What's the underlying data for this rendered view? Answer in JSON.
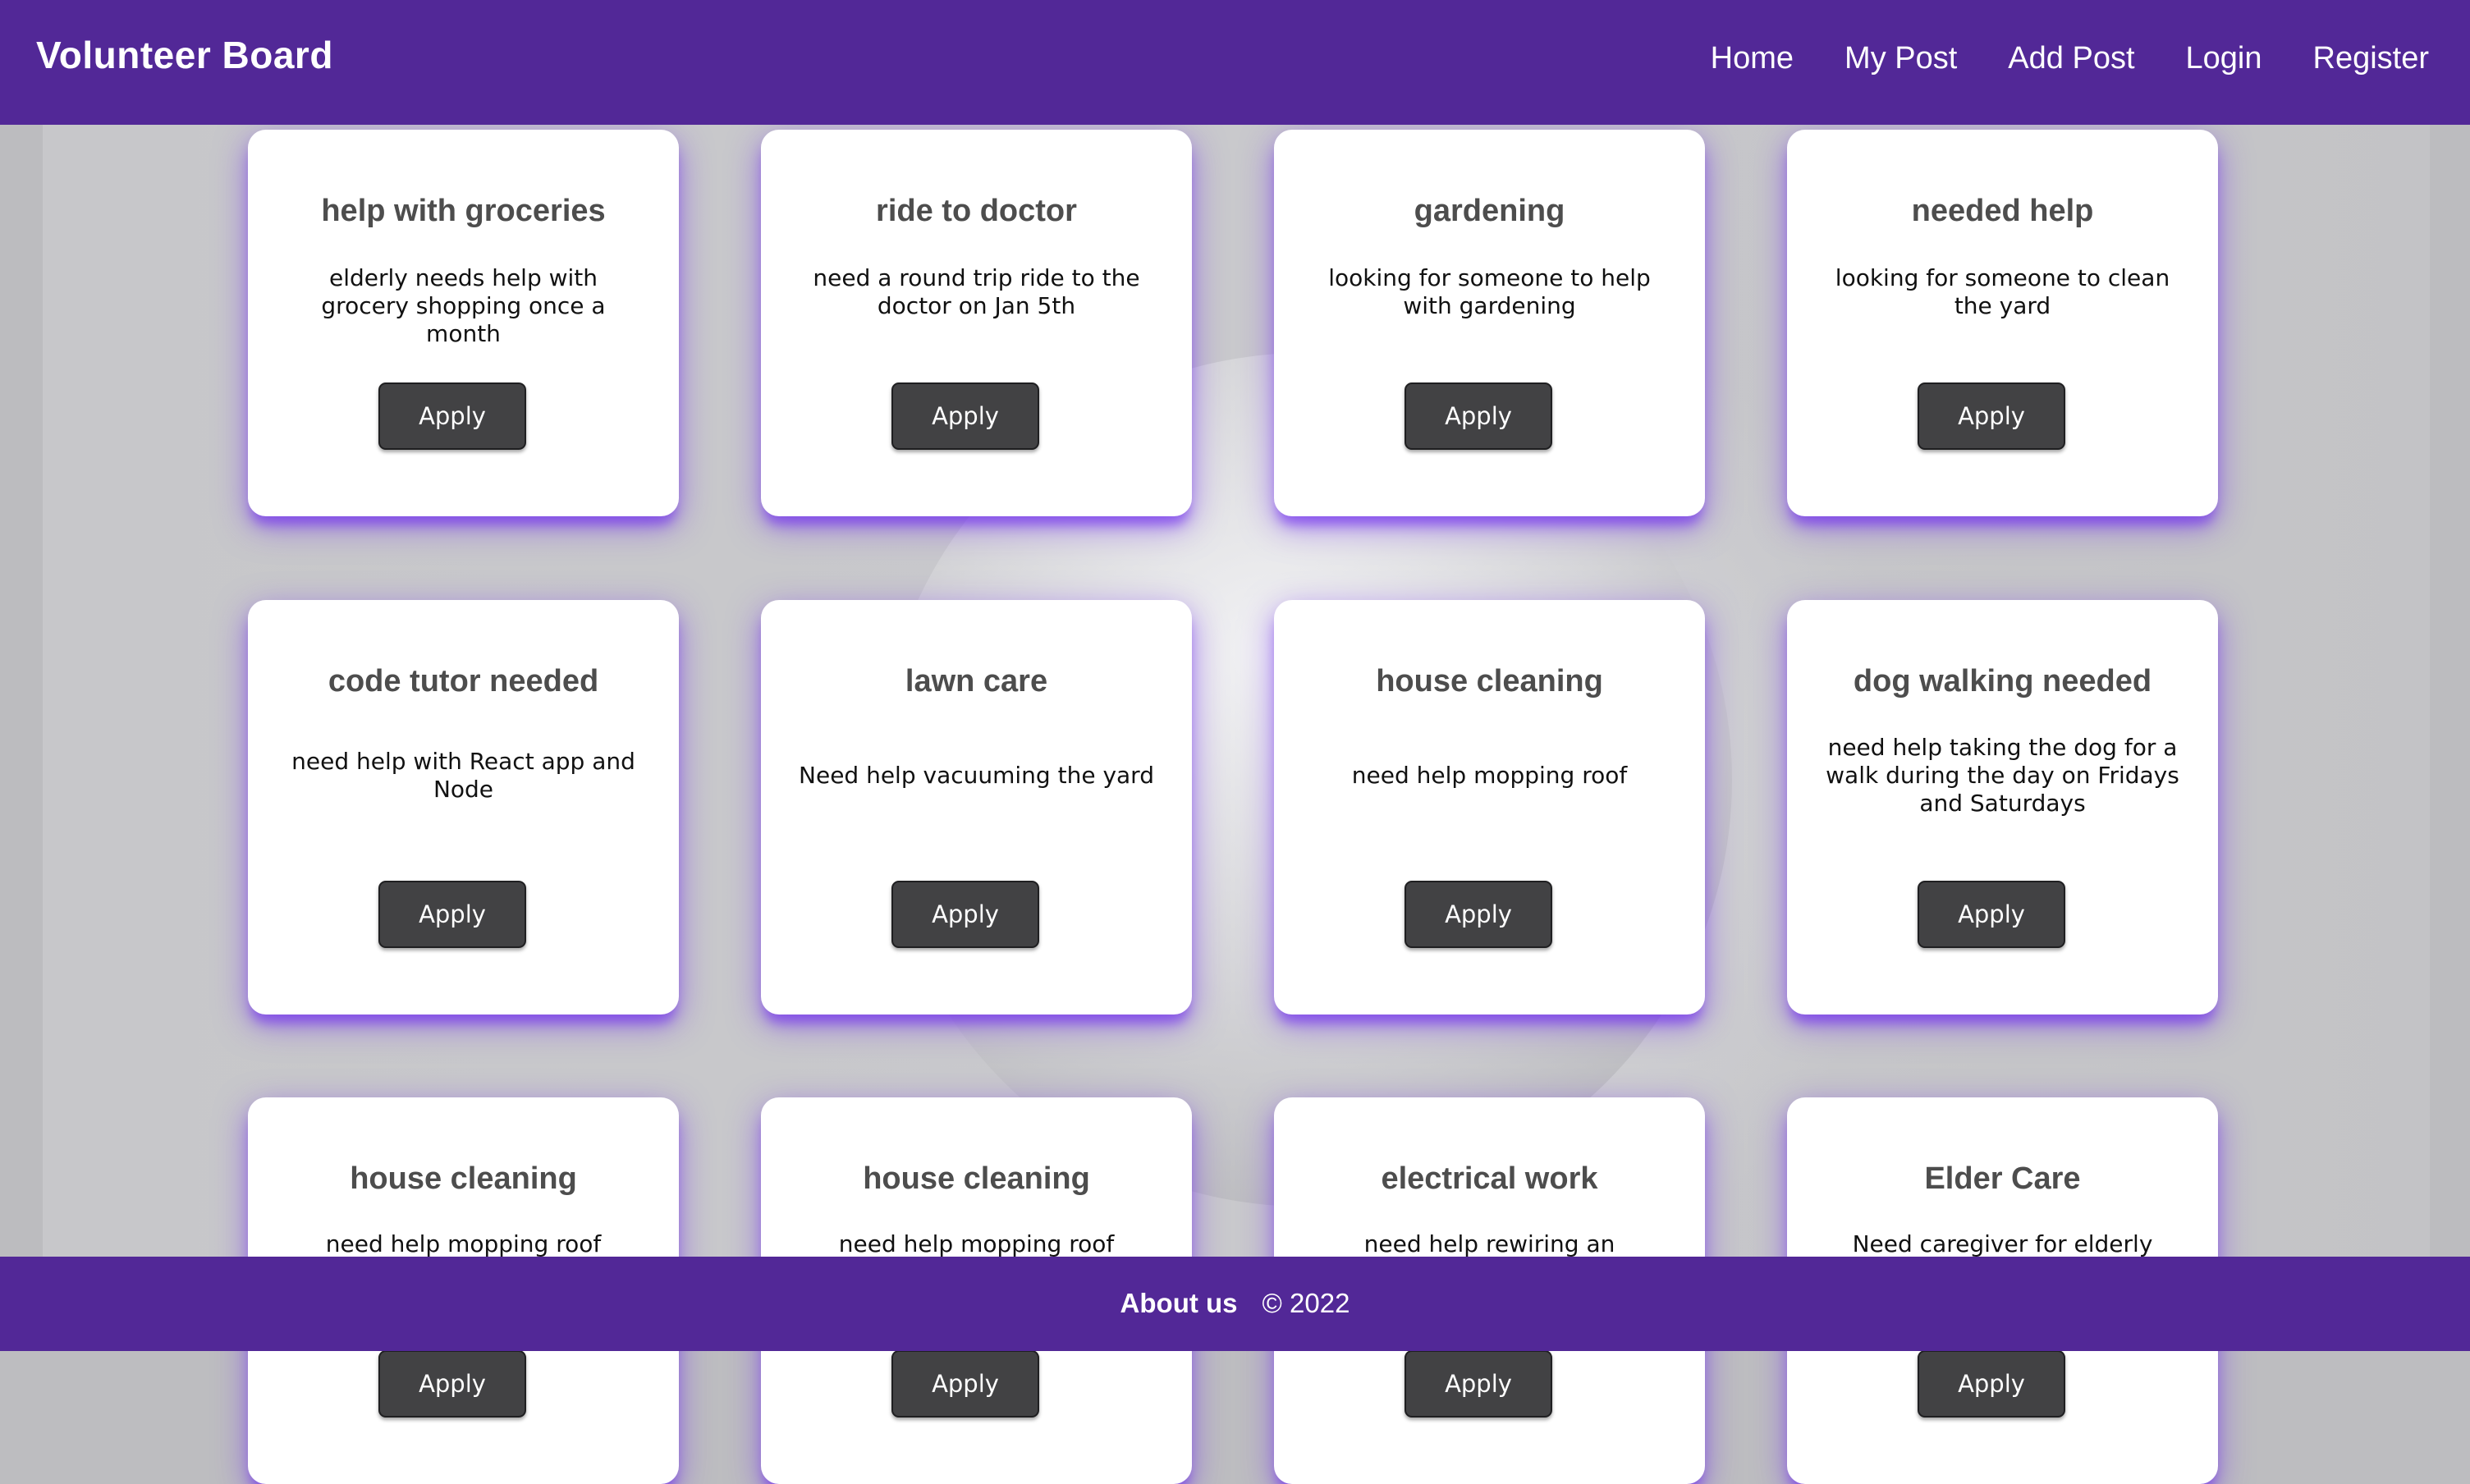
{
  "header": {
    "brand": "Volunteer Board",
    "nav": [
      "Home",
      "My Post",
      "Add Post",
      "Login",
      "Register"
    ]
  },
  "cards": [
    {
      "title": "help with groceries",
      "description": "elderly needs help with grocery shopping once a month",
      "button": "Apply"
    },
    {
      "title": "ride to doctor",
      "description": "need a round trip ride to the doctor on Jan 5th",
      "button": "Apply"
    },
    {
      "title": "gardening",
      "description": "looking for someone to help with gardening",
      "button": "Apply"
    },
    {
      "title": "needed help",
      "description": "looking for someone to clean the yard",
      "button": "Apply"
    },
    {
      "title": "code tutor needed",
      "description": "need help with React app and Node",
      "button": "Apply"
    },
    {
      "title": "lawn care",
      "description": "Need help vacuuming the yard",
      "button": "Apply"
    },
    {
      "title": "house cleaning",
      "description": "need help mopping roof",
      "button": "Apply"
    },
    {
      "title": "dog walking needed",
      "description": "need help taking the dog for a walk during the day on Fridays and Saturdays",
      "button": "Apply"
    },
    {
      "title": "house cleaning",
      "description": "need help mopping roof",
      "button": "Apply"
    },
    {
      "title": "house cleaning",
      "description": "need help mopping roof",
      "button": "Apply"
    },
    {
      "title": "electrical work",
      "description": "need help rewiring an appliance",
      "button": "Apply"
    },
    {
      "title": "Elder Care",
      "description": "Need caregiver for elderly man",
      "button": "Apply"
    }
  ],
  "footer": {
    "about_label": "About us",
    "copyright": "© 2022"
  },
  "colors": {
    "header_bg": "#522897",
    "card_shadow": "#6e28f0",
    "button_bg": "#424244"
  }
}
